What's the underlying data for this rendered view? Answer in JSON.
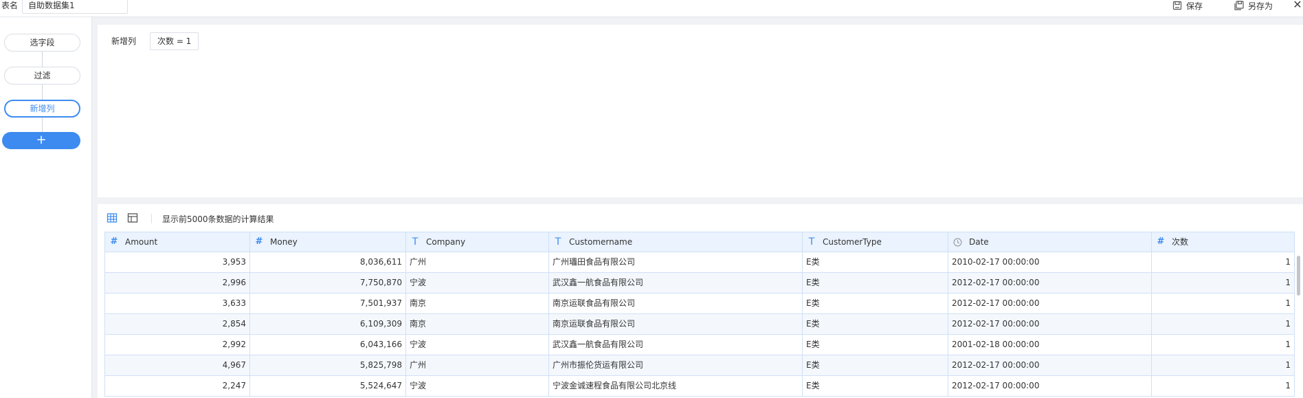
{
  "topbar": {
    "table_name_label": "表名",
    "table_name_value": "自助数据集1",
    "save_label": "保存",
    "save_as_label": "另存为",
    "close_symbol": "✕"
  },
  "sidebar": {
    "steps": [
      {
        "label": "选字段"
      },
      {
        "label": "过滤"
      },
      {
        "label": "新增列",
        "active": true
      }
    ],
    "add_symbol": "+"
  },
  "config": {
    "section_label": "新增列",
    "column_chip": "次数 = 1"
  },
  "result": {
    "info_text": "显示前5000条数据的计算结果",
    "columns": [
      {
        "name": "Amount",
        "type": "number"
      },
      {
        "name": "Money",
        "type": "number"
      },
      {
        "name": "Company",
        "type": "text"
      },
      {
        "name": "Customername",
        "type": "text"
      },
      {
        "name": "CustomerType",
        "type": "text"
      },
      {
        "name": "Date",
        "type": "date"
      },
      {
        "name": "次数",
        "type": "number"
      }
    ],
    "rows": [
      [
        "3,953",
        "8,036,611",
        "广州",
        "广州瓃田食品有限公司",
        "E类",
        "2010-02-17 00:00:00",
        "1"
      ],
      [
        "2,996",
        "7,750,870",
        "宁波",
        "武汉鑫一航食品有限公司",
        "E类",
        "2012-02-17 00:00:00",
        "1"
      ],
      [
        "3,633",
        "7,501,937",
        "南京",
        "南京运联食品有限公司",
        "E类",
        "2012-02-17 00:00:00",
        "1"
      ],
      [
        "2,854",
        "6,109,309",
        "南京",
        "南京运联食品有限公司",
        "E类",
        "2012-02-17 00:00:00",
        "1"
      ],
      [
        "2,992",
        "6,043,166",
        "宁波",
        "武汉鑫一航食品有限公司",
        "E类",
        "2001-02-18 00:00:00",
        "1"
      ],
      [
        "4,967",
        "5,825,798",
        "广州",
        "广州市振伦货运有限公司",
        "E类",
        "2012-02-17 00:00:00",
        "1"
      ],
      [
        "2,247",
        "5,524,647",
        "宁波",
        "宁波金诚速程食品有限公司北京线",
        "E类",
        "2012-02-17 00:00:00",
        "1"
      ]
    ]
  },
  "colors": {
    "accent": "#3d8bf0",
    "header_bg": "#eaf3fe",
    "row_alt_bg": "#f4f8fd",
    "border": "#cfe0f5"
  }
}
